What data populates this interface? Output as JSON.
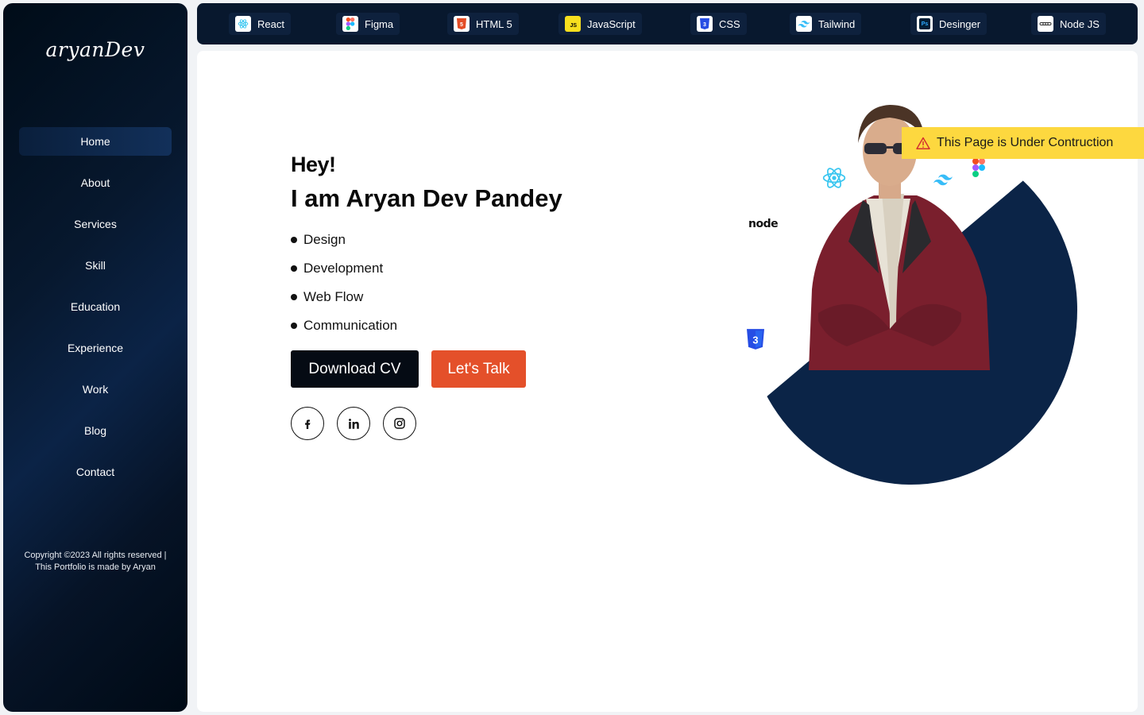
{
  "sidebar": {
    "logo": "aryanDev",
    "nav": [
      "Home",
      "About",
      "Services",
      "Skill",
      "Education",
      "Experience",
      "Work",
      "Blog",
      "Contact"
    ],
    "active": "Home",
    "copyright_line1": "Copyright ©2023 All rights reserved |",
    "copyright_line2": "This Portfolio is made by Aryan"
  },
  "topbar": {
    "skills": [
      {
        "label": "React",
        "icon": "react-icon"
      },
      {
        "label": "Figma",
        "icon": "figma-icon"
      },
      {
        "label": "HTML 5",
        "icon": "html5-icon"
      },
      {
        "label": "JavaScript",
        "icon": "javascript-icon"
      },
      {
        "label": "CSS",
        "icon": "css-icon"
      },
      {
        "label": "Tailwind",
        "icon": "tailwind-icon"
      },
      {
        "label": "Desinger",
        "icon": "photoshop-icon"
      },
      {
        "label": "Node JS",
        "icon": "nodejs-icon"
      }
    ]
  },
  "hero": {
    "greeting": "Hey!",
    "name": "I am Aryan Dev Pandey",
    "roles": [
      "Design",
      "Development",
      "Web Flow",
      "Communication"
    ],
    "download_label": "Download CV",
    "talk_label": "Let's Talk",
    "node_logo_text": "node"
  },
  "banner": {
    "text": "This Page is Under Contruction"
  },
  "colors": {
    "sidebar_dark": "#07182e",
    "accent_orange": "#e4502a",
    "banner_yellow": "#fdd83f",
    "hero_circle": "#0b2447"
  }
}
